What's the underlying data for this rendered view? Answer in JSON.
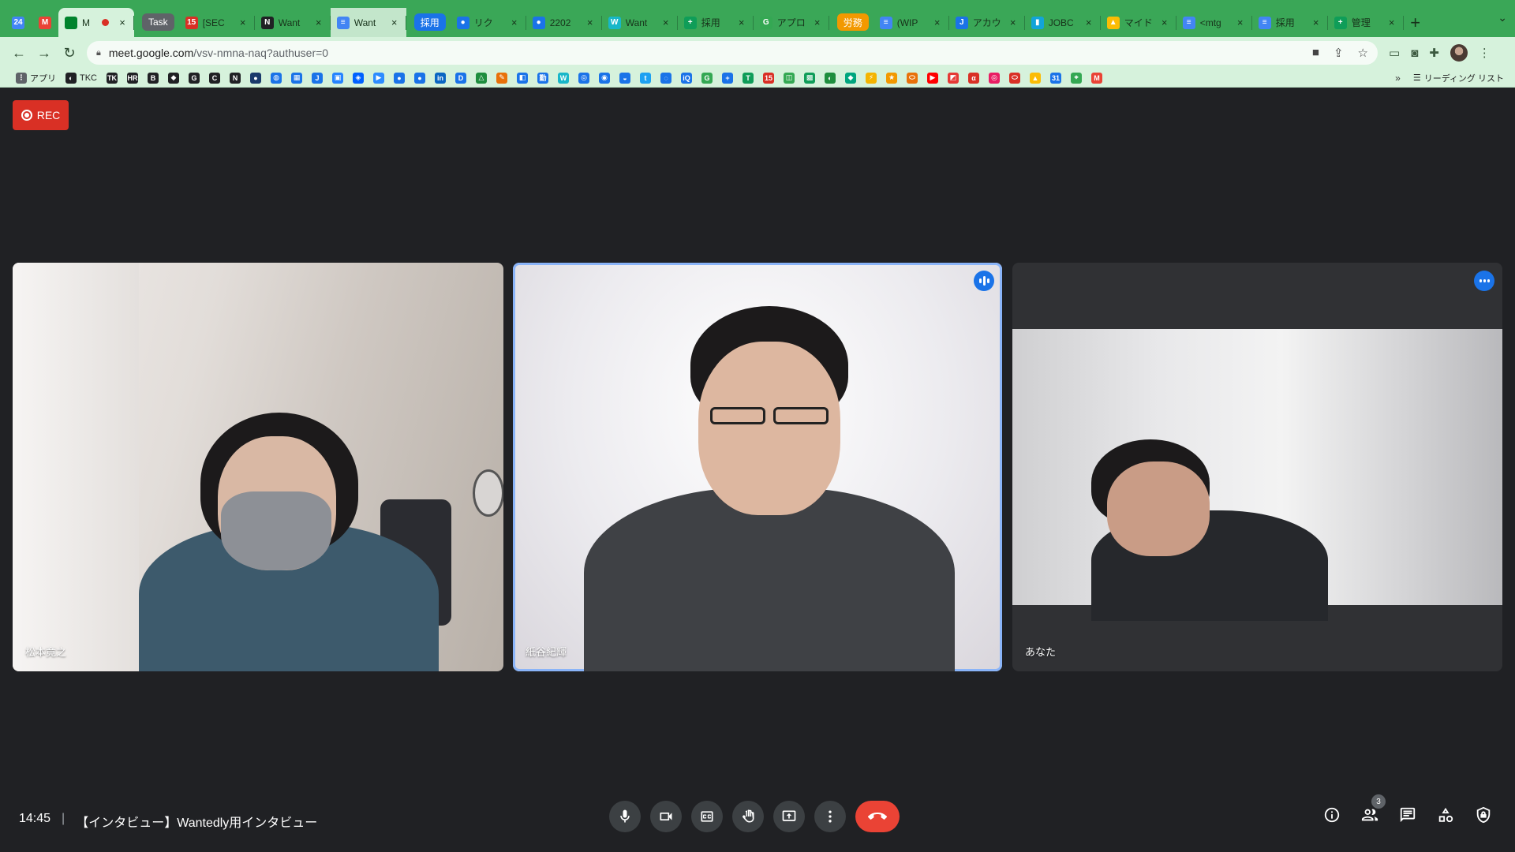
{
  "browser": {
    "tabs": [
      {
        "title": "",
        "color": "#4285f4",
        "icon": "calendar-icon",
        "pinned": true,
        "glyph": "24"
      },
      {
        "title": "",
        "color": "#ea4335",
        "icon": "gmail-icon",
        "pinned": true,
        "glyph": "M"
      },
      {
        "title": "M",
        "color": "#00832d",
        "icon": "meet-icon",
        "active": true,
        "recording": true,
        "glyph": ""
      },
      {
        "title": "Task",
        "group": true,
        "color": "#5f6368"
      },
      {
        "title": "[SEC",
        "color": "#d93025",
        "icon": "calendar-15-icon",
        "glyph": "15"
      },
      {
        "title": "Want",
        "color": "#202124",
        "icon": "notion-icon",
        "glyph": "N"
      },
      {
        "title": "Want",
        "color": "#4285f4",
        "icon": "docs-icon",
        "glyph": "≡",
        "highlight": true
      },
      {
        "title": "採用",
        "group": true,
        "color": "#1a73e8"
      },
      {
        "title": "リク",
        "color": "#1a73e8",
        "icon": "globe-icon",
        "glyph": "●"
      },
      {
        "title": "2202",
        "color": "#1a73e8",
        "icon": "globe-icon",
        "glyph": "●"
      },
      {
        "title": "Want",
        "color": "#18b7c9",
        "icon": "wantedly-icon",
        "glyph": "W"
      },
      {
        "title": "採用",
        "color": "#0f9d58",
        "icon": "sheets-icon",
        "glyph": "+"
      },
      {
        "title": "アプロ",
        "color": "#34a853",
        "icon": "google-g-icon",
        "glyph": "G"
      },
      {
        "title": "労務",
        "group": true,
        "color": "#f29900"
      },
      {
        "title": "(WIP",
        "color": "#4285f4",
        "icon": "docs-icon",
        "glyph": "≡"
      },
      {
        "title": "アカウ",
        "color": "#1a73e8",
        "icon": "jira-icon",
        "glyph": "J"
      },
      {
        "title": "JOBC",
        "color": "#12a4d9",
        "icon": "doc-icon",
        "glyph": "▮"
      },
      {
        "title": "マイド",
        "color": "#fbbc04",
        "icon": "drive-icon",
        "glyph": "▲"
      },
      {
        "title": "<mtg",
        "color": "#4285f4",
        "icon": "docs-icon",
        "glyph": "≡"
      },
      {
        "title": "採用",
        "color": "#4285f4",
        "icon": "docs-icon",
        "glyph": "≡"
      },
      {
        "title": "管理",
        "color": "#0f9d58",
        "icon": "sheets-icon",
        "glyph": "+"
      }
    ],
    "url_host": "meet.google.com",
    "url_path": "/vsv-nmna-naq?authuser=0",
    "bookmarks": [
      {
        "label": "アプリ",
        "color": "#5f6368",
        "glyph": "⋮"
      },
      {
        "label": "TKC",
        "color": "#202124",
        "glyph": "◐"
      },
      {
        "label": "",
        "color": "#202124",
        "glyph": "TK"
      },
      {
        "label": "",
        "color": "#202124",
        "glyph": "HR"
      },
      {
        "label": "",
        "color": "#202124",
        "glyph": "B"
      },
      {
        "label": "",
        "color": "#202124",
        "glyph": "◆"
      },
      {
        "label": "",
        "color": "#202124",
        "glyph": "G"
      },
      {
        "label": "",
        "color": "#202124",
        "glyph": "C"
      },
      {
        "label": "",
        "color": "#202124",
        "glyph": "N"
      },
      {
        "label": "",
        "color": "#1a3a6b",
        "glyph": "●"
      },
      {
        "label": "",
        "color": "#1a73e8",
        "glyph": "◍"
      },
      {
        "label": "",
        "color": "#1a73e8",
        "glyph": "▦"
      },
      {
        "label": "",
        "color": "#1a73e8",
        "glyph": "J"
      },
      {
        "label": "",
        "color": "#2684ff",
        "glyph": "▣"
      },
      {
        "label": "",
        "color": "#0061ff",
        "glyph": "◈"
      },
      {
        "label": "",
        "color": "#2d8cff",
        "glyph": "▶"
      },
      {
        "label": "",
        "color": "#1a73e8",
        "glyph": "●"
      },
      {
        "label": "",
        "color": "#1a73e8",
        "glyph": "●"
      },
      {
        "label": "",
        "color": "#0a66c2",
        "glyph": "in"
      },
      {
        "label": "",
        "color": "#1a73e8",
        "glyph": "D"
      },
      {
        "label": "",
        "color": "#1e8e3e",
        "glyph": "△"
      },
      {
        "label": "",
        "color": "#e8710a",
        "glyph": "✎"
      },
      {
        "label": "",
        "color": "#1a73e8",
        "glyph": "◧"
      },
      {
        "label": "",
        "color": "#1a73e8",
        "glyph": "勤"
      },
      {
        "label": "",
        "color": "#18b7c9",
        "glyph": "W"
      },
      {
        "label": "",
        "color": "#1a73e8",
        "glyph": "◎"
      },
      {
        "label": "",
        "color": "#1a73e8",
        "glyph": "◉"
      },
      {
        "label": "",
        "color": "#1a73e8",
        "glyph": "◒"
      },
      {
        "label": "",
        "color": "#1da1f2",
        "glyph": "t"
      },
      {
        "label": "",
        "color": "#1a73e8",
        "glyph": "◌"
      },
      {
        "label": "",
        "color": "#1a73e8",
        "glyph": "iQ"
      },
      {
        "label": "",
        "color": "#34a853",
        "glyph": "G"
      },
      {
        "label": "",
        "color": "#1a73e8",
        "glyph": "+"
      },
      {
        "label": "",
        "color": "#0f9d58",
        "glyph": "T"
      },
      {
        "label": "",
        "color": "#d93025",
        "glyph": "15"
      },
      {
        "label": "",
        "color": "#34a853",
        "glyph": "◫"
      },
      {
        "label": "",
        "color": "#0f9d58",
        "glyph": "▩"
      },
      {
        "label": "",
        "color": "#1e8e3e",
        "glyph": "◐"
      },
      {
        "label": "",
        "color": "#00a67e",
        "glyph": "◆"
      },
      {
        "label": "",
        "color": "#f4b400",
        "glyph": "⚡"
      },
      {
        "label": "",
        "color": "#f29900",
        "glyph": "★"
      },
      {
        "label": "",
        "color": "#e8710a",
        "glyph": "⬭"
      },
      {
        "label": "",
        "color": "#ff0000",
        "glyph": "▶"
      },
      {
        "label": "",
        "color": "#e53935",
        "glyph": "◩"
      },
      {
        "label": "",
        "color": "#d93025",
        "glyph": "α"
      },
      {
        "label": "",
        "color": "#e91e63",
        "glyph": "◎"
      },
      {
        "label": "",
        "color": "#d93025",
        "glyph": "⬭"
      },
      {
        "label": "",
        "color": "#fbbc04",
        "glyph": "▲"
      },
      {
        "label": "",
        "color": "#1a73e8",
        "glyph": "31"
      },
      {
        "label": "",
        "color": "#34a853",
        "glyph": "⌖"
      },
      {
        "label": "",
        "color": "#ea4335",
        "glyph": "M"
      }
    ],
    "bookmarks_more": "»",
    "reading_list": "リーディング リスト"
  },
  "meet": {
    "rec_label": "REC",
    "participants": [
      {
        "name": "松本竟之"
      },
      {
        "name": "紙谷紀輝"
      },
      {
        "name": "あなた"
      }
    ],
    "time": "14:45",
    "separator": "|",
    "meeting_title": "【インタビュー】Wantedly用インタビュー",
    "participant_count": "3"
  }
}
